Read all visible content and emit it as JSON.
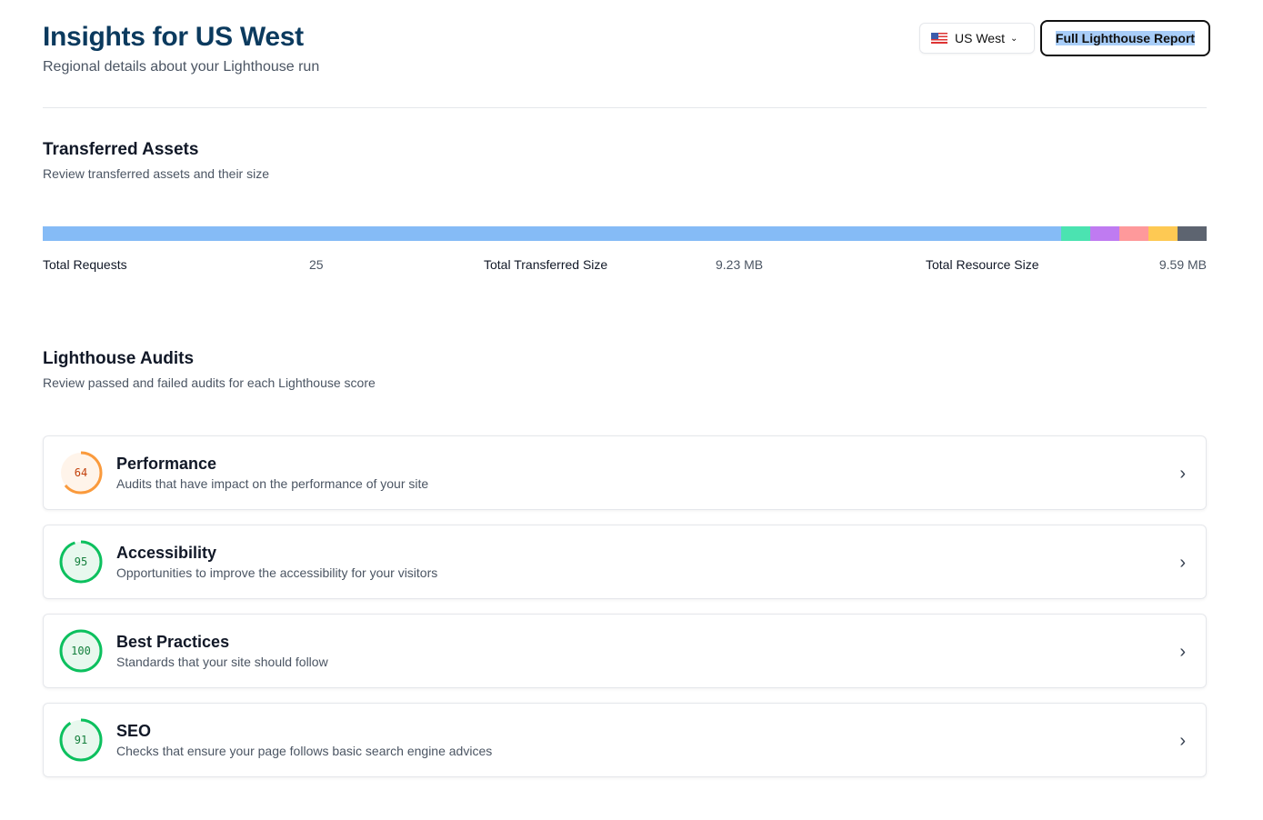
{
  "header": {
    "title": "Insights for US West",
    "subtitle": "Regional details about your Lighthouse run",
    "region": "US West",
    "region_icon": "us-flag-icon",
    "report_button": "Full Lighthouse Report"
  },
  "assets": {
    "title": "Transferred Assets",
    "subtitle": "Review transferred assets and their size",
    "segments": [
      {
        "share": 0.875,
        "color": "#85bbf6"
      },
      {
        "share": 0.025,
        "color": "#4be3b1"
      },
      {
        "share": 0.025,
        "color": "#bf7bf1"
      },
      {
        "share": 0.025,
        "color": "#fe999b"
      },
      {
        "share": 0.025,
        "color": "#fec953"
      },
      {
        "share": 0.025,
        "color": "#5d6470"
      }
    ],
    "stats": [
      {
        "label": "Total Requests",
        "value": "25"
      },
      {
        "label": "Total Transferred Size",
        "value": "9.23 MB"
      },
      {
        "label": "Total Resource Size",
        "value": "9.59 MB"
      }
    ]
  },
  "audits": {
    "title": "Lighthouse Audits",
    "subtitle": "Review passed and failed audits for each Lighthouse score",
    "items": [
      {
        "score": "64",
        "pct": 64,
        "title": "Performance",
        "desc": "Audits that have impact on the performance of your site",
        "color": "#fa9a3c",
        "bg": "#fff4ea",
        "text": "#c2410c"
      },
      {
        "score": "95",
        "pct": 95,
        "title": "Accessibility",
        "desc": "Opportunities to improve the accessibility for your visitors",
        "color": "#0cc05e",
        "bg": "#e8f8ee",
        "text": "#15803d"
      },
      {
        "score": "100",
        "pct": 100,
        "title": "Best Practices",
        "desc": "Standards that your site should follow",
        "color": "#0cc05e",
        "bg": "#e8f8ee",
        "text": "#15803d"
      },
      {
        "score": "91",
        "pct": 91,
        "title": "SEO",
        "desc": "Checks that ensure your page follows basic search engine advices",
        "color": "#0cc05e",
        "bg": "#e8f8ee",
        "text": "#15803d"
      }
    ]
  }
}
